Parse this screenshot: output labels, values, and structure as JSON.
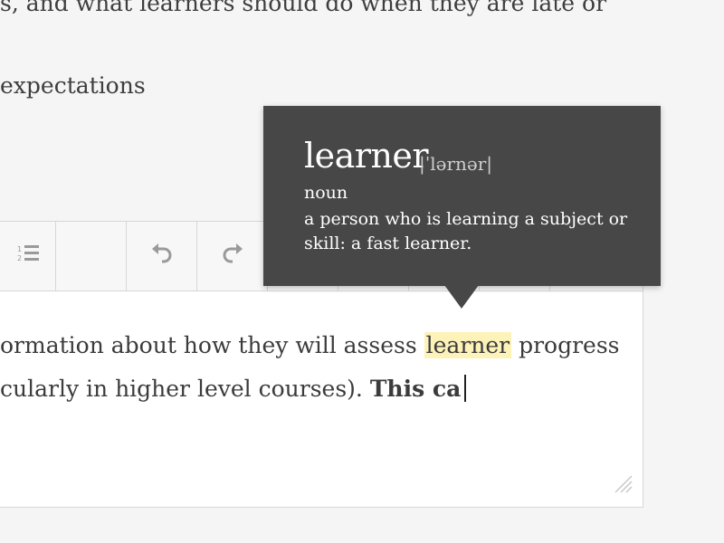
{
  "background_text": {
    "line1": "s, and what learners should do when they are late or",
    "line2": "expectations"
  },
  "toolbar": {
    "buttons": [
      {
        "icon": "numbered-list-icon",
        "label": "Numbered list"
      },
      {
        "icon": "blank",
        "label": ""
      },
      {
        "icon": "undo-icon",
        "label": "Undo"
      },
      {
        "icon": "redo-icon",
        "label": "Redo"
      }
    ]
  },
  "editor": {
    "line1_before": "ormation about how they will assess ",
    "line1_highlight": "learner",
    "line1_after": " progress",
    "line2_normal": "cularly in higher level courses). ",
    "line2_bold": "This ca"
  },
  "tooltip": {
    "word": "learner",
    "pronunciation": "|ˈlərnər|",
    "part_of_speech": "noun",
    "definition": "a person who is learning a subject or skill: a fast learner."
  },
  "colors": {
    "tooltip_bg": "#474747",
    "highlight": "#fdf2b8",
    "page_bg": "#f5f5f5",
    "editor_bg": "#ffffff"
  }
}
